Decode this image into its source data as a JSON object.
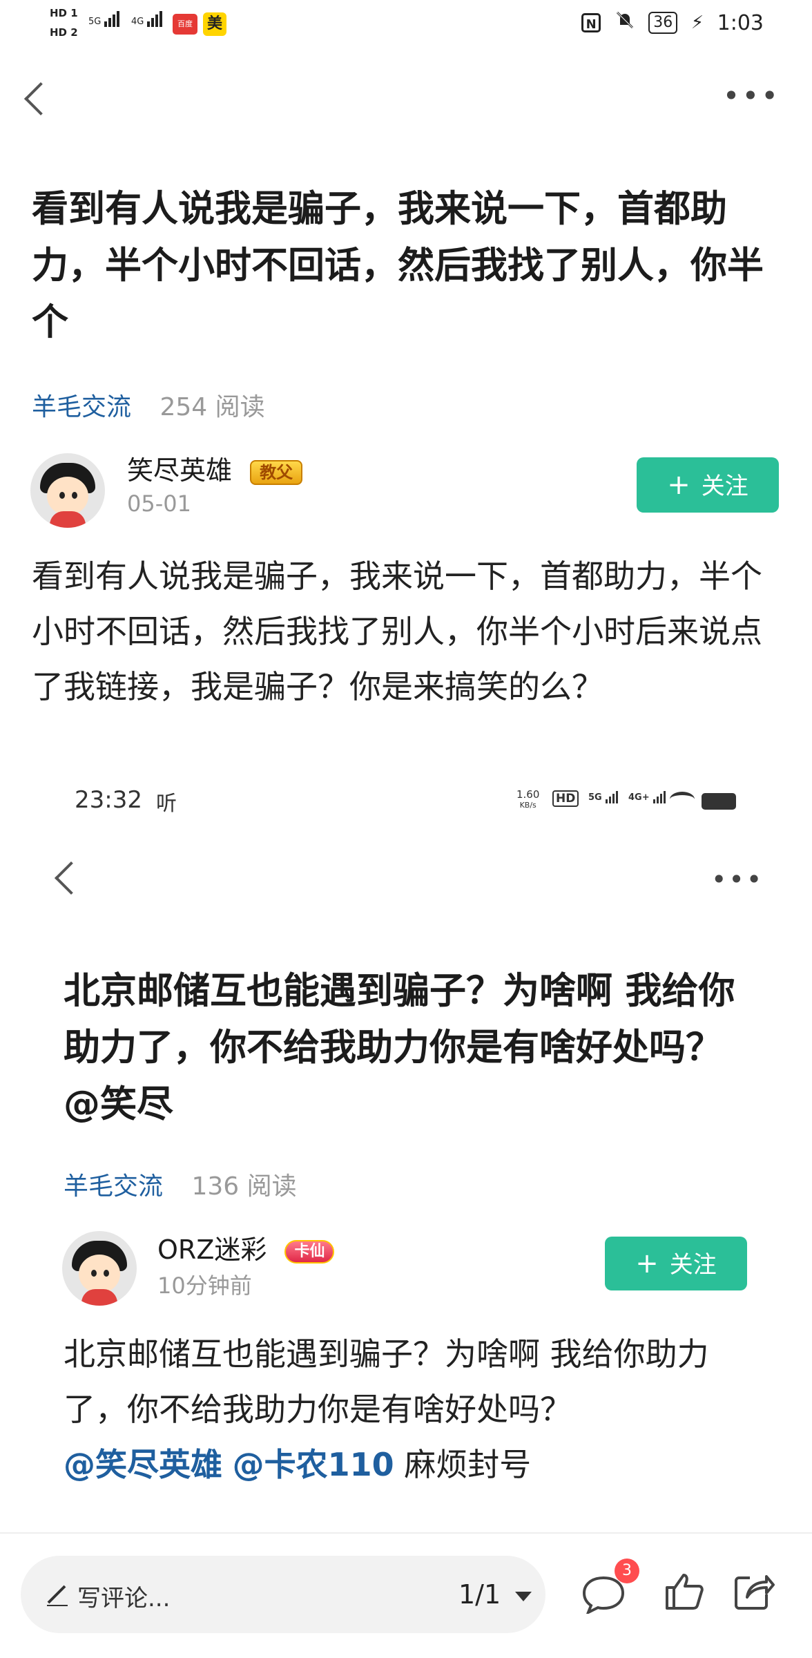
{
  "status_bar": {
    "hd1": "HD 1",
    "hd2": "HD 2",
    "sig1": "5G",
    "sig2": "4G",
    "app_badge_1": "百度",
    "app_badge_2": "美",
    "nfc": "N",
    "battery": "36",
    "time": "1:03"
  },
  "post1": {
    "title": "看到有人说我是骗子，我来说一下，首都助力，半个小时不回话，然后我找了别人，你半个",
    "channel": "羊毛交流",
    "reads": "254 阅读",
    "author": "笑尽英雄",
    "author_badge": "教父",
    "date": "05-01",
    "follow_plus": "+",
    "follow_label": "关注",
    "content": "看到有人说我是骗子，我来说一下，首都助力，半个小时不回话，然后我找了别人，你半个小时后来说点了我链接，我是骗子？你是来搞笑的么？"
  },
  "status_bar_2": {
    "time": "23:32",
    "app_icon": "听",
    "speed_1": "1.60",
    "speed_2": "KB/s",
    "hd": "HD",
    "g5": "5G",
    "g4": "4G+"
  },
  "post2": {
    "title": "北京邮储互也能遇到骗子？为啥啊 我给你助力了，你不给我助力你是有啥好处吗？ @笑尽",
    "channel": "羊毛交流",
    "reads": "136 阅读",
    "author": "ORZ迷彩",
    "author_badge": "卡仙",
    "date": "10分钟前",
    "follow_plus": "+",
    "follow_label": "关注",
    "content_text": "北京邮储互也能遇到骗子？为啥啊 我给你助力了，你不给我助力你是有啥好处吗？",
    "mention_1": "@笑尽英雄",
    "mention_2": "@卡农110",
    "content_tail": "麻烦封号"
  },
  "bottom_bar": {
    "comment_placeholder": "写评论...",
    "pager": "1/1",
    "comment_count": "3",
    "icons": [
      "pen-icon",
      "comment-icon",
      "thumbs-up-icon",
      "share-icon"
    ]
  },
  "colors": {
    "accent_green": "#2bbf98",
    "link_blue": "#1f5f9f",
    "badge_red": "#ff4d4f"
  }
}
